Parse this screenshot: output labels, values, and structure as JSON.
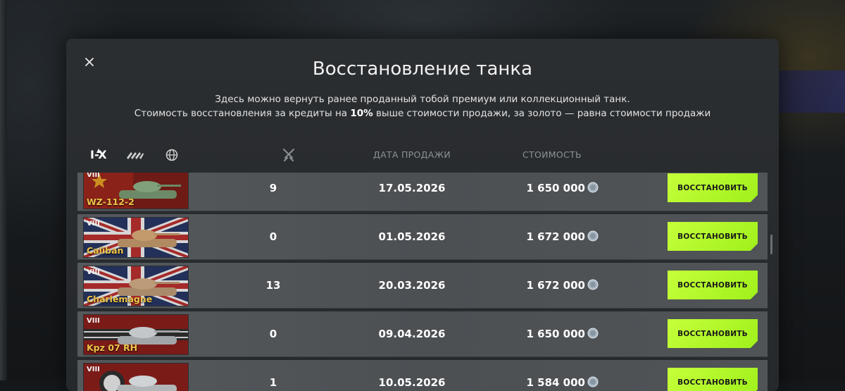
{
  "modal": {
    "title": "Восстановление танка",
    "desc_line1": "Здесь можно вернуть ранее проданный тобой премиум или коллекционный танк.",
    "desc_line2_pre": "Стоимость восстановления за кредиты на ",
    "desc_line2_bold": "10%",
    "desc_line2_post": " выше стоимости продажи, за золото — равна стоимости продажи",
    "close_icon": "close-icon"
  },
  "filters": {
    "tier_label": "I-X",
    "type_icon": "vehicle-type-icon",
    "nation_icon": "globe-icon"
  },
  "columns": {
    "battles_icon": "crossed-swords-icon",
    "date": "ДАТА ПРОДАЖИ",
    "cost": "СТОИМОСТЬ"
  },
  "rows": [
    {
      "tier": "VIII",
      "name": "WZ-112-2",
      "nation": "china",
      "battles": "9",
      "date": "17.05.2026",
      "cost": "1 650 000",
      "button": "ВОССТАНОВИТЬ"
    },
    {
      "tier": "VIII",
      "name": "Caliban",
      "nation": "uk",
      "battles": "0",
      "date": "01.05.2026",
      "cost": "1 672 000",
      "button": "ВОССТАНОВИТЬ"
    },
    {
      "tier": "VIII",
      "name": "Charlemagne",
      "nation": "uk",
      "battles": "13",
      "date": "20.03.2026",
      "cost": "1 672 000",
      "button": "ВОССТАНОВИТЬ"
    },
    {
      "tier": "VIII",
      "name": "Kpz 07 RH",
      "nation": "germany",
      "battles": "0",
      "date": "09.04.2026",
      "cost": "1 650 000",
      "button": "ВОССТАНОВИТЬ"
    },
    {
      "tier": "VIII",
      "name": "",
      "nation": "germany",
      "battles": "1",
      "date": "10.05.2026",
      "cost": "1 584 000",
      "button": "ВОССТАНОВИТЬ"
    }
  ],
  "colors": {
    "accent_button": "#b8fa2c",
    "tank_name": "#f0c44a"
  }
}
